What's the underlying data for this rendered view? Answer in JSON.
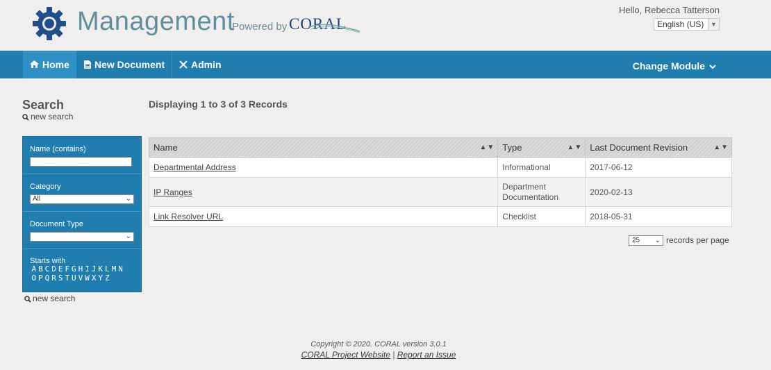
{
  "header": {
    "app_title": "Management",
    "powered_by": "Powered by",
    "coral_logo_text": "CORAL",
    "greeting": "Hello, Rebecca Tatterson",
    "language": "English (US)"
  },
  "nav": {
    "home": "Home",
    "new_document": "New Document",
    "admin": "Admin",
    "change_module": "Change Module"
  },
  "sidebar": {
    "title": "Search",
    "new_search": "new search",
    "name_label": "Name (contains)",
    "name_value": "",
    "category_label": "Category",
    "category_value": "All",
    "doc_type_label": "Document Type",
    "doc_type_value": "",
    "starts_with_label": "Starts with",
    "letters_row1": [
      "A",
      "B",
      "C",
      "D",
      "E",
      "F",
      "G",
      "H",
      "I",
      "J",
      "K",
      "L",
      "M",
      "N"
    ],
    "letters_row2": [
      "O",
      "P",
      "Q",
      "R",
      "S",
      "T",
      "U",
      "V",
      "W",
      "X",
      "Y",
      "Z"
    ]
  },
  "main": {
    "displaying": "Displaying 1 to 3 of 3 Records",
    "columns": [
      "Name",
      "Type",
      "Last Document Revision"
    ],
    "rows": [
      {
        "name": "Departmental Address",
        "type": "Informational",
        "revision": "2017-06-12"
      },
      {
        "name": "IP Ranges",
        "type": "Department Documentation",
        "revision": "2020-02-13"
      },
      {
        "name": "Link Resolver URL",
        "type": "Checklist",
        "revision": "2018-05-31"
      }
    ],
    "records_per_page_value": "25",
    "records_per_page_label": "records per page"
  },
  "footer": {
    "copyright": "Copyright © 2020. CORAL version 3.0.1",
    "project_link": "CORAL Project Website",
    "separator": "|",
    "issue_link": "Report an Issue"
  },
  "colors": {
    "nav_bg": "#1f7db0",
    "nav_active": "#2e90c4",
    "title_color": "#5d8fa0"
  }
}
